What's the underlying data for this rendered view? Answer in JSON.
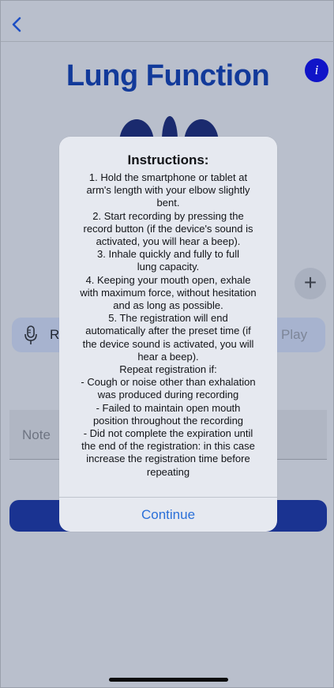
{
  "header": {
    "title": "Lung Function",
    "info_label": "i"
  },
  "recorder": {
    "record_label": "Re",
    "play_label": "Play",
    "add_label": "+"
  },
  "note": {
    "placeholder": "Note"
  },
  "dialog": {
    "title": "Instructions:",
    "text": "1. Hold the smartphone or tablet at\narm's length with your elbow slightly\nbent.\n2. Start recording by pressing the\nrecord button (if the device's sound is\nactivated, you will hear a beep).\n3. Inhale quickly and fully to full\nlung capacity.\n4. Keeping your mouth open, exhale\nwith maximum force, without hesitation\nand as long as possible.\n5. The registration will end\nautomatically after the preset time (if\nthe device sound is activated, you will\nhear a beep).\nRepeat registration if:\n- Cough or noise other than exhalation\nwas produced during recording\n- Failed to maintain open mouth\nposition throughout the recording\n- Did not complete the expiration until\nthe end of the registration: in this case\nincrease the registration time before\nrepeating",
    "continue_label": "Continue"
  },
  "colors": {
    "background": "#b9bfcc",
    "title": "#123a9a",
    "info_button": "#1014c8",
    "primary_button": "#1a3391",
    "dialog_link": "#2a6fd8"
  },
  "icons": [
    "chevron-left-icon",
    "info-icon",
    "microphone-icon",
    "plus-icon"
  ]
}
